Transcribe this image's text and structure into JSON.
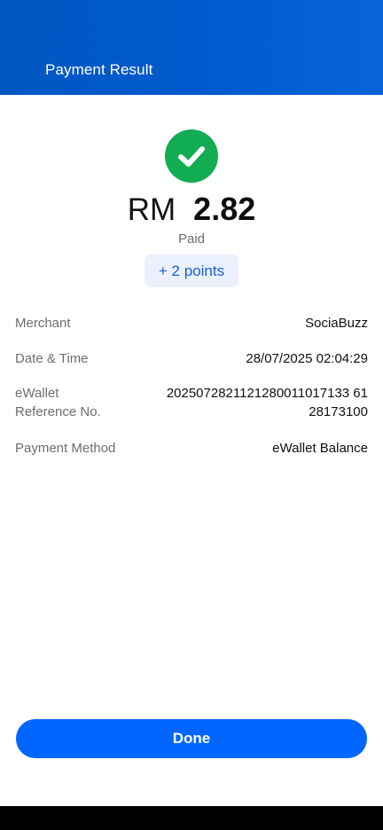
{
  "header": {
    "title": "Payment Result"
  },
  "result": {
    "icon": "check-icon",
    "status_color": "#12ad52",
    "currency": "RM",
    "amount": "2.82",
    "status": "Paid",
    "points": "+ 2 points"
  },
  "details": {
    "merchant_label": "Merchant",
    "merchant_value": "SociaBuzz",
    "datetime_label": "Date & Time",
    "datetime_value": "28/07/2025 02:04:29",
    "reference_label_line1": "eWallet",
    "reference_label_line2": "Reference No.",
    "reference_value_line1": "2025072821121280011017133 61",
    "reference_value_line2": "28173100",
    "method_label": "Payment Method",
    "method_value": "eWallet Balance"
  },
  "actions": {
    "done_label": "Done",
    "accent_color": "#0066ff"
  }
}
